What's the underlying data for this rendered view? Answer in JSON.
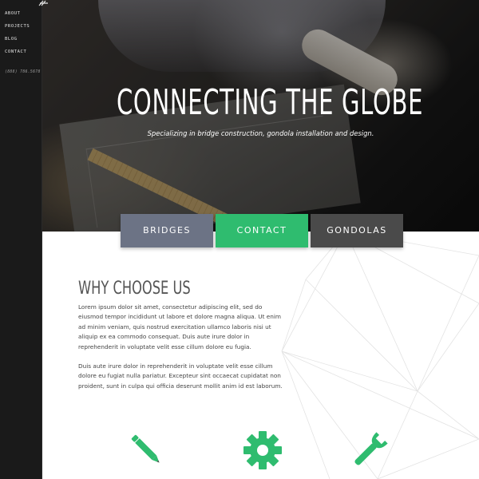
{
  "nav": {
    "items": [
      {
        "label": "ABOUT"
      },
      {
        "label": "PROJECTS"
      },
      {
        "label": "BLOG"
      },
      {
        "label": "CONTACT"
      }
    ],
    "phone": "(888) 786.5678"
  },
  "hero": {
    "title": "CONNECTING THE GLOBE",
    "subtitle": "Specializing in bridge construction, gondola installation and design."
  },
  "tabs": [
    {
      "label": "BRIDGES",
      "color": "#6c7385"
    },
    {
      "label": "CONTACT",
      "color": "#2fbc6f"
    },
    {
      "label": "GONDOLAS",
      "color": "#4a4a4a"
    }
  ],
  "section": {
    "title": "WHY CHOOSE US",
    "paragraph1": "Lorem ipsum dolor sit amet, consectetur adipiscing elit, sed do eiusmod tempor incididunt ut labore et dolore magna aliqua. Ut enim ad minim veniam, quis nostrud exercitation ullamco laboris nisi ut aliquip ex ea commodo consequat. Duis aute irure dolor in reprehenderit in voluptate velit esse cillum dolore eu fugia.",
    "paragraph2": "Duis aute irure dolor in reprehenderit in voluptate velit esse cillum dolore eu fugiat nulla pariatur. Excepteur sint occaecat cupidatat non proident, sunt in culpa qui officia deserunt mollit anim id est laborum."
  },
  "features": [
    {
      "icon": "pencil-icon"
    },
    {
      "icon": "gear-icon"
    },
    {
      "icon": "wrench-icon"
    }
  ],
  "colors": {
    "accent": "#2fbc6f",
    "sidebar": "#1a1a1a",
    "heading": "#555555"
  }
}
